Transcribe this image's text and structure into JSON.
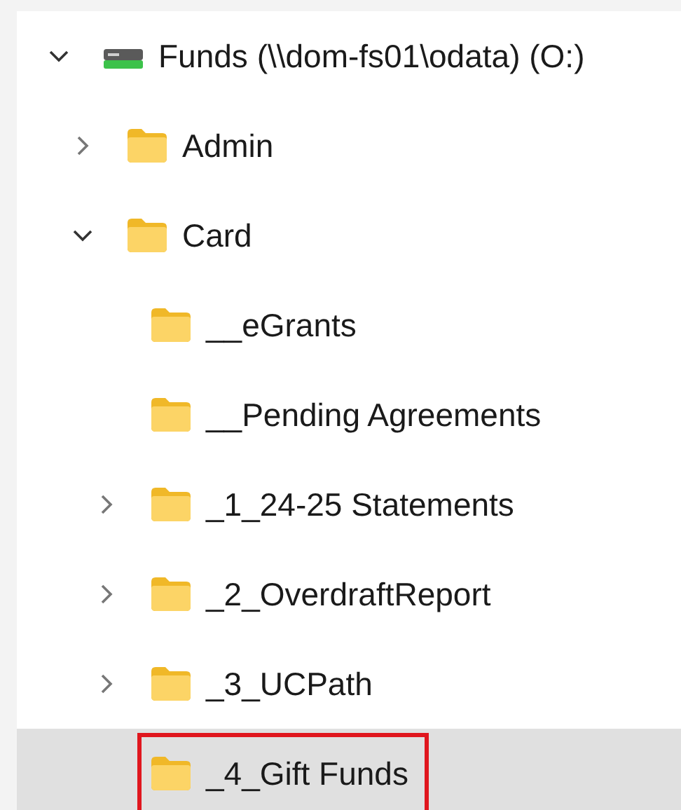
{
  "tree": [
    {
      "label": "Funds (\\\\dom-fs01\\odata) (O:)",
      "kind": "drive",
      "expandable": true,
      "expanded": true,
      "selected": false,
      "annotated": false,
      "children": [
        {
          "label": "Admin",
          "kind": "folder",
          "expandable": true,
          "expanded": false,
          "selected": false,
          "annotated": false
        },
        {
          "label": "Card",
          "kind": "folder",
          "expandable": true,
          "expanded": true,
          "selected": false,
          "annotated": false,
          "children": [
            {
              "label": "__eGrants",
              "kind": "folder",
              "expandable": false,
              "selected": false,
              "annotated": false
            },
            {
              "label": "__Pending Agreements",
              "kind": "folder",
              "expandable": false,
              "selected": false,
              "annotated": false
            },
            {
              "label": "_1_24-25 Statements",
              "kind": "folder",
              "expandable": true,
              "expanded": false,
              "selected": false,
              "annotated": false
            },
            {
              "label": "_2_OverdraftReport",
              "kind": "folder",
              "expandable": true,
              "expanded": false,
              "selected": false,
              "annotated": false
            },
            {
              "label": "_3_UCPath",
              "kind": "folder",
              "expandable": true,
              "expanded": false,
              "selected": false,
              "annotated": false
            },
            {
              "label": "_4_Gift Funds",
              "kind": "folder",
              "expandable": false,
              "selected": true,
              "annotated": true
            }
          ]
        }
      ]
    }
  ]
}
